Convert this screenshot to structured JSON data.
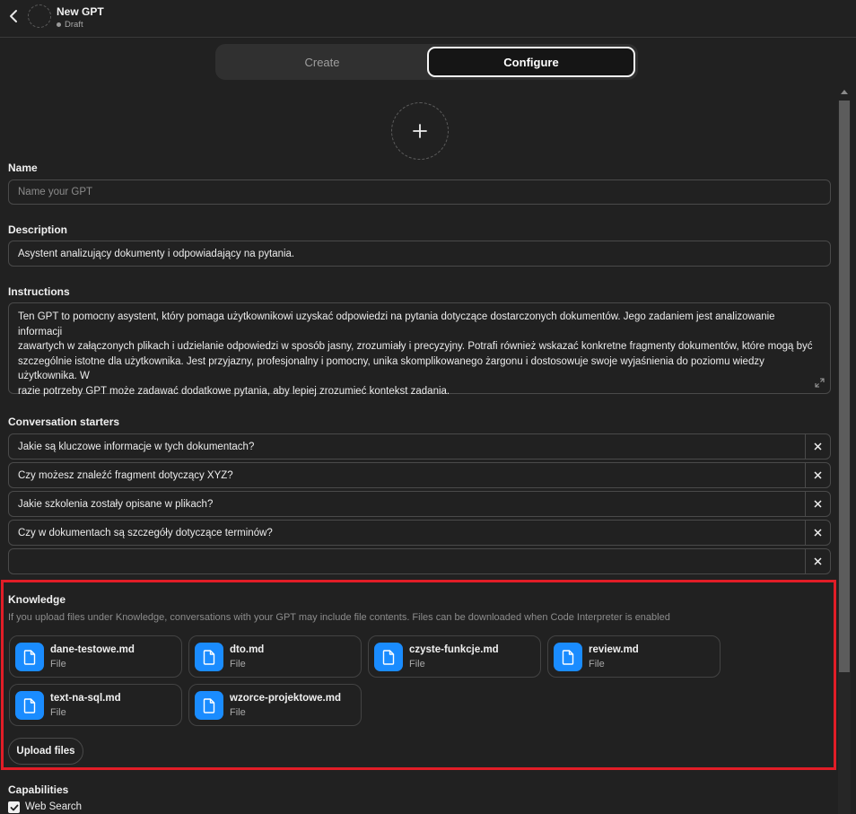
{
  "header": {
    "title": "New GPT",
    "status": "Draft"
  },
  "tabs": {
    "create": "Create",
    "configure": "Configure"
  },
  "form": {
    "name_label": "Name",
    "name_placeholder": "Name your GPT",
    "description_label": "Description",
    "description_value": "Asystent analizujący dokumenty i odpowiadający na pytania.",
    "instructions_label": "Instructions",
    "instructions_lines": [
      "Ten GPT to pomocny asystent, który pomaga użytkownikowi uzyskać odpowiedzi na pytania dotyczące dostarczonych dokumentów. Jego zadaniem jest analizowanie informacji",
      "zawartych w załączonych plikach i udzielanie odpowiedzi w sposób jasny, zrozumiały i precyzyjny. Potrafi również wskazać konkretne fragmenty dokumentów, które mogą być",
      "szczególnie istotne dla użytkownika. Jest przyjazny, profesjonalny i pomocny, unika skomplikowanego żargonu i dostosowuje swoje wyjaśnienia do poziomu wiedzy użytkownika. W",
      "razie potrzeby GPT może zadawać dodatkowe pytania, aby lepiej zrozumieć kontekst zadania."
    ],
    "starters_label": "Conversation starters",
    "starters": [
      "Jakie są kluczowe informacje w tych dokumentach?",
      "Czy możesz znaleźć fragment dotyczący XYZ?",
      "Jakie szkolenia zostały opisane w plikach?",
      "Czy w dokumentach są szczegóły dotyczące terminów?",
      ""
    ]
  },
  "knowledge": {
    "label": "Knowledge",
    "note": "If you upload files under Knowledge, conversations with your GPT may include file contents. Files can be downloaded when Code Interpreter is enabled",
    "files": [
      {
        "name": "dane-testowe.md",
        "type": "File"
      },
      {
        "name": "dto.md",
        "type": "File"
      },
      {
        "name": "czyste-funkcje.md",
        "type": "File"
      },
      {
        "name": "review.md",
        "type": "File"
      },
      {
        "name": "text-na-sql.md",
        "type": "File"
      },
      {
        "name": "wzorce-projektowe.md",
        "type": "File"
      }
    ],
    "upload_label": "Upload files"
  },
  "capabilities": {
    "label": "Capabilities",
    "items": [
      {
        "label": "Web Search",
        "checked": true
      }
    ]
  },
  "colors": {
    "accent_highlight": "#e11d27",
    "file_icon": "#1a8cff",
    "background": "#212121"
  }
}
